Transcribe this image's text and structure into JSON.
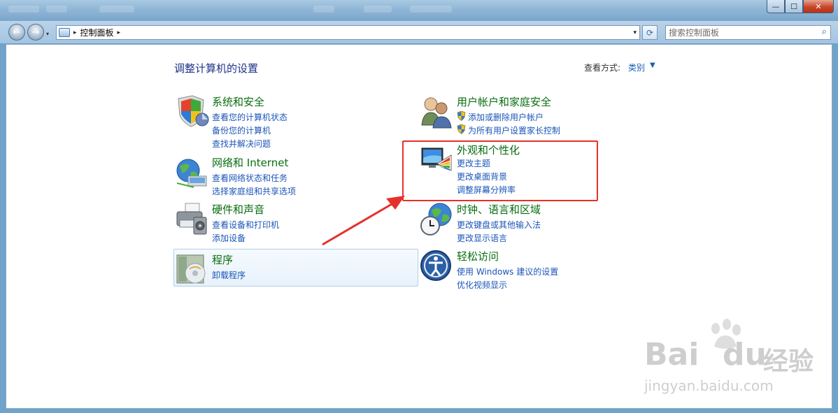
{
  "window": {
    "minimize_glyph": "—",
    "maximize_glyph": "☐",
    "close_glyph": "✕"
  },
  "toolbar": {
    "back_glyph": "←",
    "forward_glyph": "→",
    "breadcrumb": "控制面板",
    "crumb_sep": "▸",
    "addr_drop_glyph": "▾",
    "refresh_glyph": "⟳",
    "search_placeholder": "搜索控制面板",
    "search_glyph": "⌕"
  },
  "main": {
    "heading": "调整计算机的设置",
    "view_by_label": "查看方式:",
    "view_by_value": "类别",
    "view_by_caret": "▼"
  },
  "categories": [
    {
      "title": "系统和安全",
      "links": [
        "查看您的计算机状态",
        "备份您的计算机",
        "查找并解决问题"
      ]
    },
    {
      "title": "网络和 Internet",
      "links": [
        "查看网络状态和任务",
        "选择家庭组和共享选项"
      ]
    },
    {
      "title": "硬件和声音",
      "links": [
        "查看设备和打印机",
        "添加设备"
      ]
    },
    {
      "title": "程序",
      "links": [
        "卸载程序"
      ]
    },
    {
      "title": "用户帐户和家庭安全",
      "links": [
        "添加或删除用户帐户",
        "为所有用户设置家长控制"
      ]
    },
    {
      "title": "外观和个性化",
      "links": [
        "更改主题",
        "更改桌面背景",
        "调整屏幕分辨率"
      ]
    },
    {
      "title": "时钟、语言和区域",
      "links": [
        "更改键盘或其他输入法",
        "更改显示语言"
      ]
    },
    {
      "title": "轻松访问",
      "links": [
        "使用 Windows 建议的设置",
        "优化视频显示"
      ]
    }
  ],
  "annotation": {
    "box_color": "#e5312b",
    "arrow_color": "#e5312b"
  },
  "watermark": {
    "brand": "Bai",
    "brand2": "du",
    "cn": "经验",
    "url": "jingyan.baidu.com"
  },
  "colors": {
    "category_title": "#086d0f",
    "link": "#1b55b8",
    "heading": "#1e3287"
  }
}
